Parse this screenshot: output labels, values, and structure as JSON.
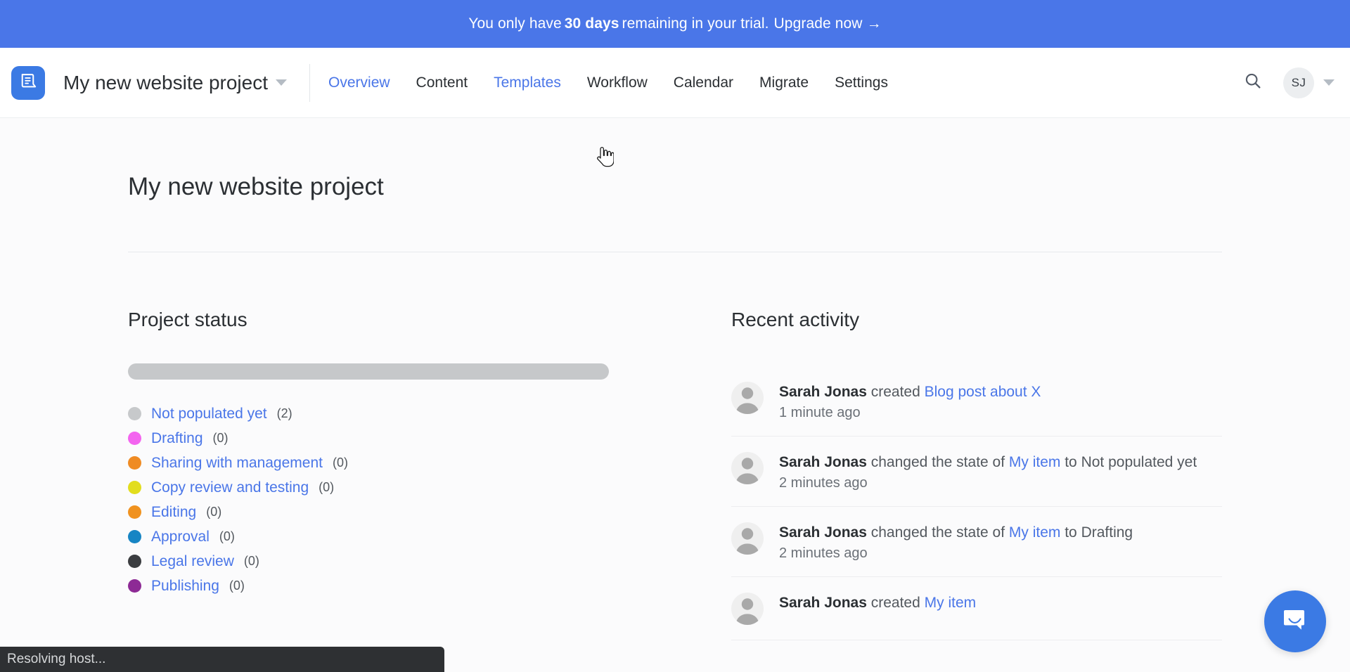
{
  "banner": {
    "prefix": "You only have ",
    "strong": "30 days",
    "suffix": " remaining in your trial.",
    "link": "Upgrade now",
    "arrow": "→"
  },
  "topnav": {
    "logo_icon": "document-logo-icon",
    "project_name": "My new website project",
    "caret_icon": "chevron-down-icon",
    "links": [
      {
        "label": "Overview",
        "state": "active"
      },
      {
        "label": "Content",
        "state": ""
      },
      {
        "label": "Templates",
        "state": "hover"
      },
      {
        "label": "Workflow",
        "state": ""
      },
      {
        "label": "Calendar",
        "state": ""
      },
      {
        "label": "Migrate",
        "state": ""
      },
      {
        "label": "Settings",
        "state": ""
      }
    ],
    "search_icon": "search-icon",
    "avatar_initials": "SJ",
    "avatar_caret_icon": "chevron-down-icon"
  },
  "page": {
    "title": "My new website project"
  },
  "project_status": {
    "heading": "Project status",
    "progress": [
      {
        "label": "Not populated yet",
        "percent": 100,
        "color": "#c6c8ca"
      }
    ],
    "legend": [
      {
        "label": "Not populated yet",
        "count": "(2)",
        "color": "#c7c9cb"
      },
      {
        "label": "Drafting",
        "count": "(0)",
        "color": "#f364ef"
      },
      {
        "label": "Sharing with management",
        "count": "(0)",
        "color": "#ef8b23"
      },
      {
        "label": "Copy review and testing",
        "count": "(0)",
        "color": "#e2dd1d"
      },
      {
        "label": "Editing",
        "count": "(0)",
        "color": "#f0921f"
      },
      {
        "label": "Approval",
        "count": "(0)",
        "color": "#1785c4"
      },
      {
        "label": "Legal review",
        "count": "(0)",
        "color": "#3b3d40"
      },
      {
        "label": "Publishing",
        "count": "(0)",
        "color": "#8d2a95"
      }
    ]
  },
  "recent_activity": {
    "heading": "Recent activity",
    "items": [
      {
        "who": "Sarah Jonas",
        "verb": " created ",
        "ref": "Blog post about X",
        "tail": "",
        "time": "1 minute ago"
      },
      {
        "who": "Sarah Jonas",
        "verb": " changed the state of ",
        "ref": "My item",
        "tail": " to Not populated yet",
        "time": "2 minutes ago"
      },
      {
        "who": "Sarah Jonas",
        "verb": " changed the state of ",
        "ref": "My item",
        "tail": " to Drafting",
        "time": "2 minutes ago"
      },
      {
        "who": "Sarah Jonas",
        "verb": " created ",
        "ref": "My item",
        "tail": "",
        "time": ""
      }
    ]
  },
  "chat": {
    "icon": "chat-bubble-icon"
  },
  "status_bar": {
    "text": "Resolving host..."
  },
  "colors": {
    "brand_blue": "#4a76e8",
    "logo_blue": "#3b7ae4",
    "link_blue": "#4a76e8",
    "text_dark": "#2b2f33",
    "text_muted": "#53585e",
    "page_bg": "#fbfbfc",
    "status_bar_bg": "#2e3033"
  }
}
